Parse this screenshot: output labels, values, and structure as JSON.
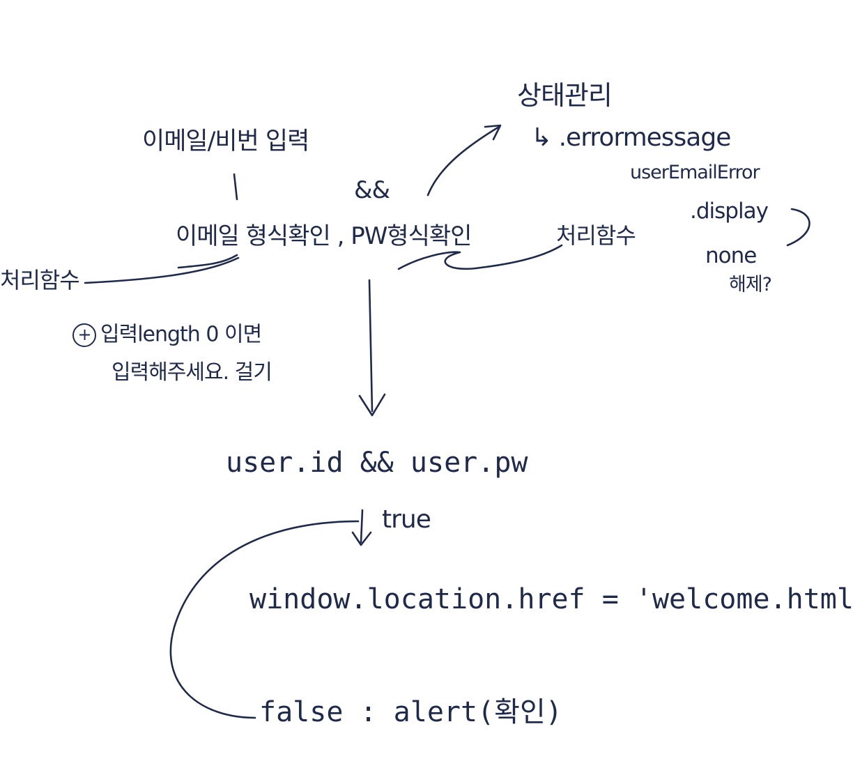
{
  "notes": {
    "state_management": "상태관리",
    "error_message": "↳ .errormessage",
    "user_email_error": "userEmailError",
    "display": ".display",
    "none": "none",
    "question": "해제?",
    "input": "이메일/비번 입력",
    "and_top": "&&",
    "validate": "이메일 형식확인 , PW형식확인",
    "handler_left": "처리함수",
    "handler_right": "처리함수",
    "plus_note_line1": "입력length 0 이면",
    "plus_note_line2": "입력해주세요. 걸기",
    "plus_symbol": "+",
    "user_check": "user.id && user.pw",
    "true_label": "true",
    "redirect": "window.location.href = 'welcome.html'",
    "false_branch": "false : alert(확인)"
  },
  "colors": {
    "ink": "#1f2a4a",
    "background": "#ffffff"
  }
}
